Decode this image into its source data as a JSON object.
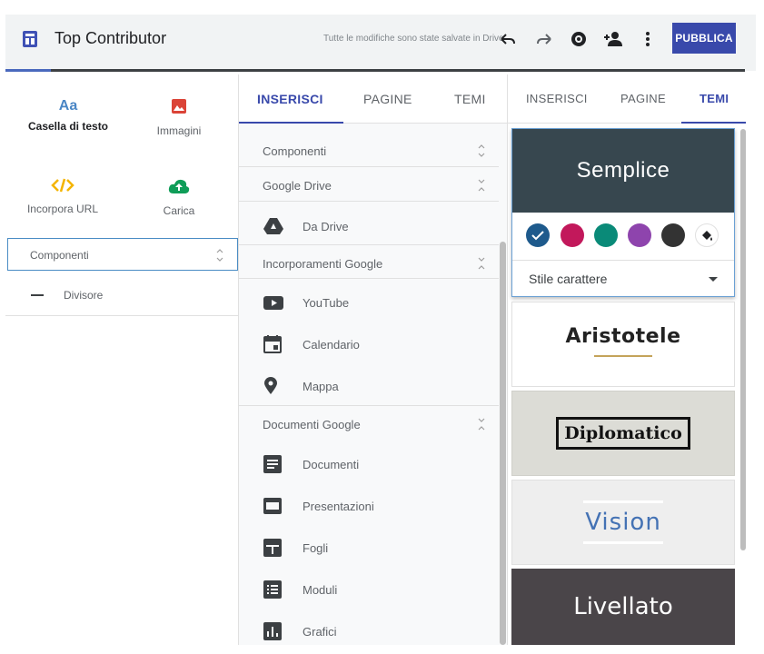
{
  "header": {
    "title": "Top Contributor",
    "save_status": "Tutte le modifiche sono state salvate in Drive",
    "publish_label": "PUBBLICA",
    "icons": [
      "site-logo-icon",
      "undo-icon",
      "redo-icon",
      "preview-icon",
      "add-person-icon",
      "more-vert-icon"
    ]
  },
  "left_panel": {
    "items": [
      {
        "label": "Casella di testo",
        "icon": "text-box-icon"
      },
      {
        "label": "Immagini",
        "icon": "image-icon"
      },
      {
        "label": "Incorpora URL",
        "icon": "embed-code-icon"
      },
      {
        "label": "Carica",
        "icon": "upload-cloud-icon"
      }
    ],
    "section": {
      "label": "Componenti"
    },
    "divider_item": {
      "label": "Divisore"
    }
  },
  "middle_panel": {
    "tabs": [
      {
        "label": "INSERISCI",
        "active": true
      },
      {
        "label": "PAGINE",
        "active": false
      },
      {
        "label": "TEMI",
        "active": false
      }
    ],
    "sections": [
      {
        "label": "Componenti",
        "items": []
      },
      {
        "label": "Google Drive",
        "items": [
          {
            "label": "Da Drive",
            "icon": "drive-icon"
          }
        ]
      },
      {
        "label": "Incorporamenti Google",
        "items": [
          {
            "label": "YouTube",
            "icon": "youtube-icon"
          },
          {
            "label": "Calendario",
            "icon": "calendar-icon"
          },
          {
            "label": "Mappa",
            "icon": "map-pin-icon"
          }
        ]
      },
      {
        "label": "Documenti Google",
        "items": [
          {
            "label": "Documenti",
            "icon": "docs-icon"
          },
          {
            "label": "Presentazioni",
            "icon": "slides-icon"
          },
          {
            "label": "Fogli",
            "icon": "sheets-icon"
          },
          {
            "label": "Moduli",
            "icon": "forms-icon"
          },
          {
            "label": "Grafici",
            "icon": "charts-icon"
          }
        ]
      }
    ]
  },
  "right_panel": {
    "tabs": [
      {
        "label": "INSERISCI",
        "active": false
      },
      {
        "label": "PAGINE",
        "active": false
      },
      {
        "label": "TEMI",
        "active": true
      }
    ],
    "themes": [
      {
        "name": "Semplice",
        "selected": true
      },
      {
        "name": "Aristotele",
        "selected": false
      },
      {
        "name": "Diplomatico",
        "selected": false
      },
      {
        "name": "Vision",
        "selected": false
      },
      {
        "name": "Livellato",
        "selected": false
      }
    ],
    "color_swatches": [
      "#1e5a8c",
      "#c2185b",
      "#0a8a78",
      "#8e44ad",
      "#333333"
    ],
    "selected_swatch_index": 0,
    "font_style_label": "Stile carattere"
  },
  "colors": {
    "accent": "#3949ab",
    "semplice_bg": "#37474f",
    "diplomatico_bg": "#dcdcd6",
    "vision_bg": "#eeeeee",
    "vision_text": "#4472b4",
    "livellato_bg": "#4a4549",
    "aristotele_rule": "#c4a35a"
  }
}
